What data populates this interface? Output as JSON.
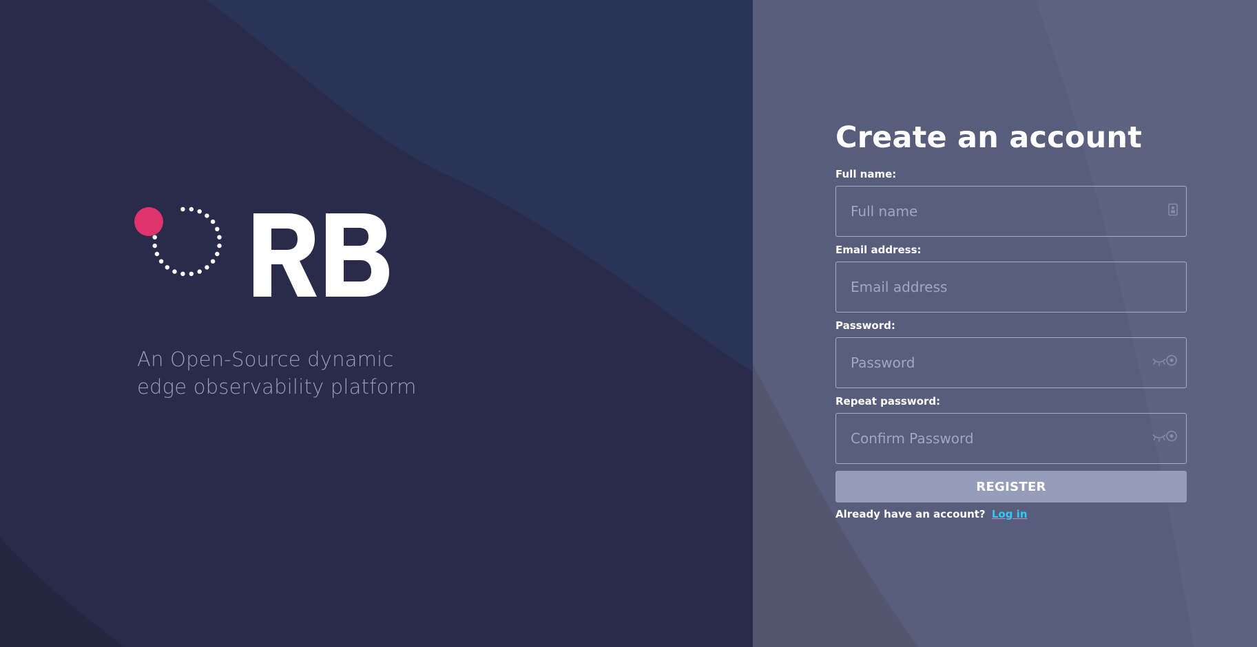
{
  "brand": {
    "logo_text": "ORB",
    "tagline": "An Open-Source dynamic edge observability platform",
    "accent_color": "#e0346f"
  },
  "form": {
    "title": "Create an account",
    "full_name": {
      "label": "Full name:",
      "placeholder": "Full name",
      "icon": "id-card-icon"
    },
    "email": {
      "label": "Email address:",
      "placeholder": "Email address"
    },
    "password": {
      "label": "Password:",
      "placeholder": "Password",
      "icon": "eye-closed-icon"
    },
    "repeat_password": {
      "label": "Repeat password:",
      "placeholder": "Confirm Password",
      "icon": "eye-closed-icon"
    },
    "register_label": "REGISTER",
    "login_prompt": "Already have an account?",
    "login_link": "Log in"
  },
  "colors": {
    "left_bg": "#2a2b4a",
    "right_bg": "#585d7c",
    "button": "#959dbb",
    "link": "#38c6f4"
  }
}
